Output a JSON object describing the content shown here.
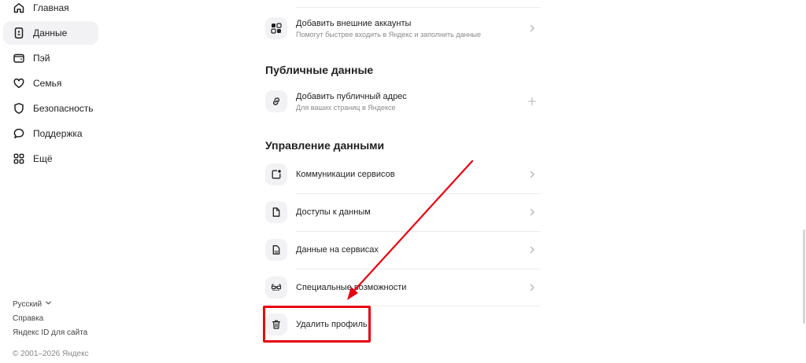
{
  "sidebar": {
    "items": [
      {
        "label": "Главная",
        "icon": "home-icon"
      },
      {
        "label": "Данные",
        "icon": "id-card-icon",
        "active": true
      },
      {
        "label": "Пэй",
        "icon": "wallet-icon"
      },
      {
        "label": "Семья",
        "icon": "heart-icon"
      },
      {
        "label": "Безопасность",
        "icon": "shield-icon"
      },
      {
        "label": "Поддержка",
        "icon": "chat-bubble-icon"
      },
      {
        "label": "Ещё",
        "icon": "grid-icon"
      }
    ],
    "footer": {
      "language": "Русский",
      "help": "Справка",
      "yandex_id_for_site": "Яндекс ID для сайта",
      "copyright": "© 2001–2026 Яндекс"
    }
  },
  "main": {
    "accounts_row": {
      "title": "Добавить внешние аккаунты",
      "subtitle": "Помогут быстрее входить в Яндекс и заполнить данные",
      "icon": "external-accounts-icon"
    },
    "public_section": {
      "title": "Публичные данные",
      "row": {
        "title": "Добавить публичный адрес",
        "subtitle": "Для ваших страниц в Яндексе",
        "icon": "link-icon",
        "end_icon": "plus-icon"
      }
    },
    "manage_section": {
      "title": "Управление данными",
      "rows": [
        {
          "title": "Коммуникации сервисов",
          "icon": "notification-square-icon"
        },
        {
          "title": "Доступы к данным",
          "icon": "document-icon"
        },
        {
          "title": "Данные на сервисах",
          "icon": "file-data-icon"
        },
        {
          "title": "Специальные возможности",
          "icon": "glasses-icon"
        },
        {
          "title": "Удалить профиль",
          "icon": "trash-icon"
        }
      ]
    }
  },
  "annotation": {
    "color": "#e60012",
    "target": "Удалить профиль"
  }
}
